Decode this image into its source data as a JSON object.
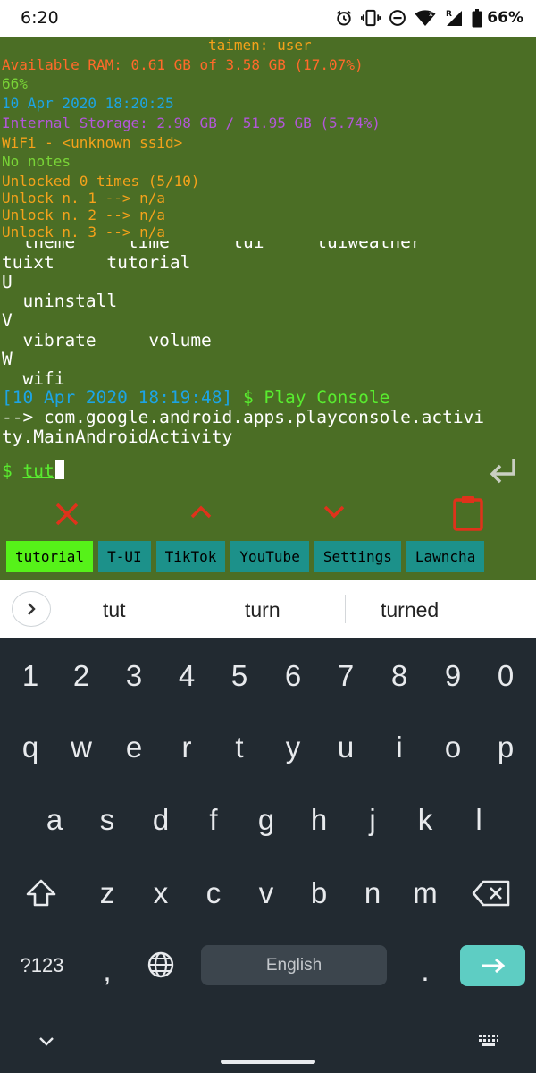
{
  "status_bar": {
    "time": "6:20",
    "battery": "66%",
    "icons": [
      "alarm-icon",
      "vibrate-icon",
      "do-not-disturb-icon",
      "wifi-icon",
      "signal-icon",
      "battery-icon"
    ]
  },
  "terminal": {
    "header": "taimen: user",
    "ram": "Available RAM: 0.61 GB of 3.58 GB (17.07%)",
    "battery_level": "66%",
    "datetime": "10 Apr 2020 18:20:25",
    "storage": "Internal Storage: 2.98 GB / 51.95 GB (5.74%)",
    "wifi": "WiFi - <unknown ssid>",
    "notes": "No notes",
    "unlocked": "Unlocked 0 times (5/10)",
    "unlocks": [
      "Unlock n. 1 --> n/a",
      "Unlock n. 2 --> n/a",
      "Unlock n. 3 --> n/a"
    ],
    "partial_line": "  theme     time      tui     tuiweather",
    "output_lines": [
      "tuixt     tutorial",
      "U",
      "  uninstall",
      "V",
      "  vibrate     volume",
      "W",
      "  wifi"
    ],
    "last_command_time": "[10 Apr 2020 18:19:48]",
    "last_command": " $ Play Console",
    "launch_output": "--> com.google.android.apps.playconsole.activi\nty.MainAndroidActivity",
    "prompt": "$ ",
    "input_value": "tut"
  },
  "colors": {
    "terminal_bg": "#4b6e25",
    "orange": "#f5a21b",
    "red": "#ff6a2a",
    "green": "#79d437",
    "blue": "#1da4e4",
    "purple": "#b357d9",
    "chip_active": "#56f219",
    "chip": "#1c918a",
    "enter_key": "#5ecdc3"
  },
  "toolbar": {
    "icons": [
      "close-icon",
      "chevron-up-icon",
      "chevron-down-icon",
      "clipboard-icon",
      "enter-arrow-icon"
    ]
  },
  "suggestion_chips": [
    "tutorial",
    "T-UI",
    "TikTok",
    "YouTube",
    "Settings",
    "Lawncha"
  ],
  "keyboard": {
    "suggestions": [
      "tut",
      "turn",
      "turned"
    ],
    "numbers": [
      "1",
      "2",
      "3",
      "4",
      "5",
      "6",
      "7",
      "8",
      "9",
      "0"
    ],
    "row1": [
      "q",
      "w",
      "e",
      "r",
      "t",
      "y",
      "u",
      "i",
      "o",
      "p"
    ],
    "row2": [
      "a",
      "s",
      "d",
      "f",
      "g",
      "h",
      "j",
      "k",
      "l"
    ],
    "row3": [
      "z",
      "x",
      "c",
      "v",
      "b",
      "n",
      "m"
    ],
    "symbols_label": "?123",
    "comma": ",",
    "period": ".",
    "space_label": "English"
  }
}
